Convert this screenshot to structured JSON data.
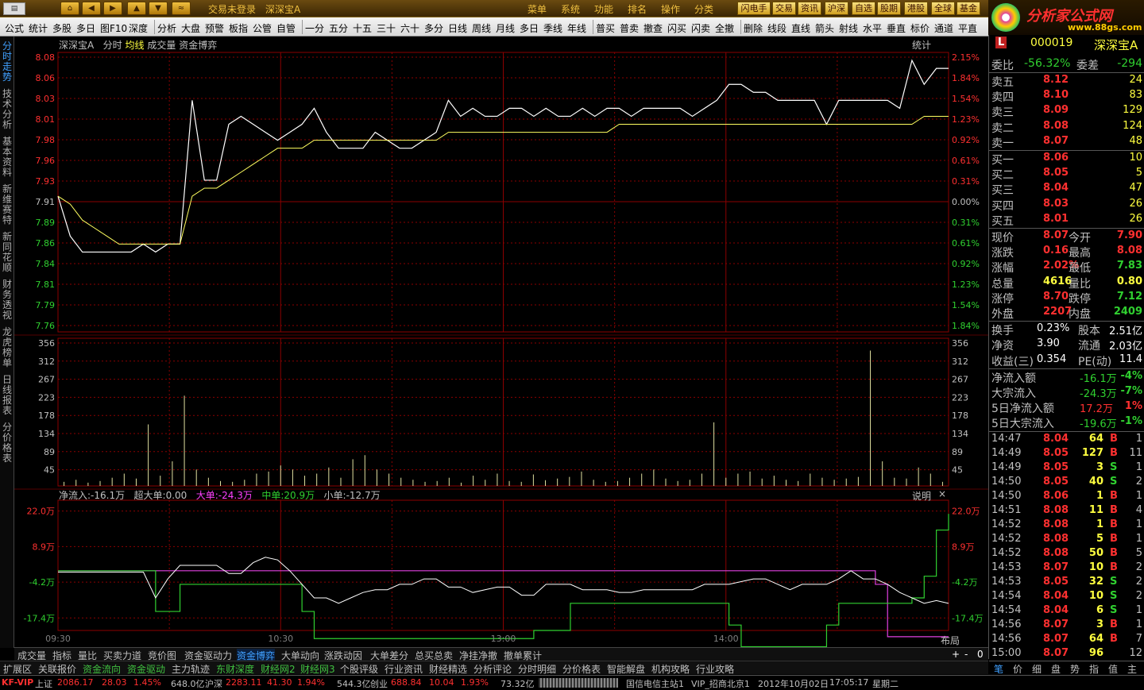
{
  "titlebar": {
    "app_icon": "app-logo-icon",
    "links": [
      "交易未登录",
      "深深宝A"
    ],
    "menus": [
      "菜单",
      "系统",
      "功能",
      "排名",
      "操作",
      "分类"
    ],
    "quick": [
      "闪电手",
      "交易",
      "资讯",
      "沪深",
      "自选",
      "股期",
      "港股",
      "全球",
      "基金"
    ]
  },
  "logo": {
    "brand": "分析家公式网",
    "url": "www.88gs.com"
  },
  "toolbar": {
    "items": [
      "公式",
      "统计",
      "多股",
      "多日",
      "图F10",
      "深度",
      "分析",
      "大盘",
      "预警",
      "板指",
      "公管",
      "自管",
      "一分",
      "五分",
      "十五",
      "三十",
      "六十",
      "多分",
      "日线",
      "周线",
      "月线",
      "多日",
      "季线",
      "年线",
      "普买",
      "普卖",
      "撤查",
      "闪买",
      "闪卖",
      "全撤",
      "删除",
      "线段",
      "直线",
      "箭头",
      "射线",
      "水平",
      "垂直",
      "标价",
      "通道",
      "平直"
    ]
  },
  "vtabs": [
    "分时走势",
    "技术分析",
    "基本资料",
    "新维赛特",
    "新同花顺",
    "财务透视",
    "龙虎榜单",
    "日线报表",
    "分价格表"
  ],
  "chart": {
    "header_name": "深深宝A",
    "header_items": [
      "分时",
      "均线",
      "成交量",
      "资金博弈"
    ],
    "stat_btn": "统计",
    "price_labels": [
      "8.08",
      "8.06",
      "8.03",
      "8.01",
      "7.98",
      "7.96",
      "7.93",
      "7.91",
      "7.89",
      "7.86",
      "7.84",
      "7.81",
      "7.79",
      "7.76"
    ],
    "pct_labels": [
      "2.15%",
      "1.84%",
      "1.54%",
      "1.23%",
      "0.92%",
      "0.61%",
      "0.31%",
      "0.00%",
      "0.31%",
      "0.61%",
      "0.92%",
      "1.23%",
      "1.54%",
      "1.84%"
    ],
    "vol_labels": [
      "356",
      "312",
      "267",
      "223",
      "178",
      "134",
      "89",
      "45"
    ],
    "flow_labels": [
      "22.0万",
      "8.9万",
      "-4.2万",
      "-17.4万"
    ],
    "flow_header": {
      "net": "净流入:-16.1万",
      "super": "超大单:0.00",
      "big": "大单:-24.3万",
      "mid": "中单:20.9万",
      "small": "小单:-12.7万",
      "help": "说明",
      "close": "×"
    },
    "time_labels": [
      "09:30",
      "10:30",
      "13:00",
      "14:00"
    ],
    "layout_btn": "布局",
    "zoom": [
      "+",
      "-",
      "0"
    ]
  },
  "chart_data": {
    "type": "line",
    "title": "深深宝A",
    "preclose": 7.91,
    "price": [
      7.91,
      7.86,
      7.84,
      7.84,
      7.84,
      7.84,
      7.84,
      7.85,
      7.84,
      7.85,
      7.85,
      8.03,
      7.93,
      7.93,
      8.0,
      8.01,
      8.0,
      7.99,
      7.98,
      7.99,
      8.0,
      8.02,
      7.99,
      7.97,
      7.97,
      7.97,
      7.99,
      7.98,
      7.97,
      7.97,
      7.98,
      7.99,
      8.03,
      8.01,
      8.02,
      8.01,
      8.01,
      8.02,
      8.02,
      8.01,
      8.02,
      8.01,
      8.01,
      8.02,
      8.01,
      8.02,
      8.02,
      8.01,
      8.02,
      8.02,
      8.02,
      8.02,
      8.01,
      8.02,
      8.03,
      8.05,
      8.05,
      8.04,
      8.04,
      8.03,
      8.03,
      8.03,
      8.03,
      8.0,
      8.03,
      8.03,
      8.03,
      8.03,
      8.03,
      8.02,
      8.08,
      8.05,
      8.07,
      8.07
    ],
    "avg": [
      7.91,
      7.9,
      7.88,
      7.87,
      7.86,
      7.85,
      7.85,
      7.85,
      7.85,
      7.85,
      7.85,
      7.91,
      7.92,
      7.92,
      7.93,
      7.94,
      7.95,
      7.96,
      7.97,
      7.97,
      7.97,
      7.98,
      7.98,
      7.98,
      7.98,
      7.98,
      7.98,
      7.98,
      7.98,
      7.98,
      7.98,
      7.98,
      7.99,
      7.99,
      7.99,
      7.99,
      7.99,
      7.99,
      7.99,
      7.99,
      7.99,
      7.99,
      7.99,
      7.99,
      7.99,
      7.99,
      8.0,
      8.0,
      8.0,
      8.0,
      8.0,
      8.0,
      8.0,
      8.0,
      8.0,
      8.0,
      8.0,
      8.0,
      8.0,
      8.0,
      8.0,
      8.0,
      8.0,
      8.0,
      8.0,
      8.0,
      8.0,
      8.0,
      8.0,
      8.0,
      8.0,
      8.01,
      8.01,
      8.01
    ],
    "volume": [
      10,
      15,
      8,
      12,
      20,
      30,
      18,
      150,
      25,
      60,
      220,
      40,
      20,
      12,
      10,
      15,
      30,
      35,
      50,
      40,
      25,
      30,
      45,
      20,
      65,
      75,
      40,
      30,
      20,
      15,
      10,
      12,
      20,
      8,
      25,
      15,
      30,
      12,
      10,
      28,
      14,
      18,
      22,
      35,
      15,
      10,
      12,
      20,
      30,
      40,
      18,
      12,
      15,
      30,
      155,
      20,
      30,
      35,
      18,
      25,
      15,
      12,
      30,
      20,
      15,
      18,
      22,
      330,
      60,
      20,
      18,
      45,
      30,
      10
    ],
    "net_flow": [
      -0.5,
      -0.5,
      -0.5,
      -0.5,
      -0.5,
      -0.5,
      -0.5,
      -0.5,
      -10,
      -3,
      2,
      2,
      2,
      2,
      -1,
      -1,
      3,
      5,
      4,
      0,
      -5,
      -10,
      -10,
      -12,
      -10,
      -8,
      -7,
      -7,
      -5,
      -5,
      -3,
      -3,
      -6,
      -6,
      -8,
      -7,
      -6,
      -6,
      -9,
      -9,
      -5,
      -5,
      -5,
      -7,
      -7,
      -7,
      -8,
      -8,
      -7,
      -7,
      -7,
      -7,
      -7,
      -5,
      -5,
      -5,
      -4,
      -3,
      -3,
      -5,
      -7,
      -5,
      -5,
      -5,
      -3,
      0,
      -3,
      -3,
      -5,
      -8,
      -10,
      -12,
      -11,
      -12
    ],
    "big_order": [
      0,
      0,
      0,
      0,
      0,
      0,
      0,
      0,
      0,
      0,
      0,
      0,
      0,
      0,
      0,
      0,
      0,
      0,
      0,
      0,
      0,
      0,
      0,
      0,
      0,
      0,
      0,
      0,
      0,
      0,
      0,
      0,
      0,
      0,
      0,
      0,
      0,
      0,
      0,
      0,
      0,
      0,
      0,
      0,
      0,
      0,
      0,
      0,
      0,
      0,
      0,
      0,
      0,
      0,
      0,
      0,
      0,
      0,
      0,
      0,
      0,
      0,
      0,
      0,
      0,
      0,
      0,
      -5,
      -24.3,
      -24.3,
      -24.3,
      -24.3,
      -24.3,
      -24.3
    ],
    "mid_order": [
      0,
      0,
      0,
      0,
      0,
      0,
      0,
      0,
      -15,
      -15,
      -5,
      -5,
      -5,
      -5,
      -5,
      -5,
      -5,
      -5,
      -5,
      -5,
      -15,
      -25,
      -25,
      -25,
      -25,
      -25,
      -25,
      -25,
      -25,
      -25,
      -25,
      -25,
      -25,
      -25,
      -25,
      -25,
      -25,
      -25,
      -25,
      -22,
      -22,
      -22,
      -12,
      -12,
      -12,
      -12,
      -12,
      -12,
      -12,
      -12,
      -12,
      -12,
      -12,
      -12,
      -12,
      -20,
      -28,
      -28,
      -28,
      -28,
      -28,
      -28,
      -28,
      -20,
      -12,
      -12,
      -12,
      -12,
      -12,
      -12,
      -10,
      -2,
      15,
      21
    ],
    "flow_range": [
      -22,
      26
    ],
    "price_range": [
      7.74,
      8.09
    ],
    "vol_range": [
      0,
      360
    ]
  },
  "quote": {
    "code": "000019",
    "name": "深深宝A",
    "weibi": {
      "label": "委比",
      "value": "-56.32%",
      "diff_label": "委差",
      "diff": "-294"
    },
    "asks": [
      {
        "label": "卖五",
        "price": "8.12",
        "vol": "24"
      },
      {
        "label": "卖四",
        "price": "8.10",
        "vol": "83"
      },
      {
        "label": "卖三",
        "price": "8.09",
        "vol": "129"
      },
      {
        "label": "卖二",
        "price": "8.08",
        "vol": "124"
      },
      {
        "label": "卖一",
        "price": "8.07",
        "vol": "48"
      }
    ],
    "bids": [
      {
        "label": "买一",
        "price": "8.06",
        "vol": "10"
      },
      {
        "label": "买二",
        "price": "8.05",
        "vol": "5"
      },
      {
        "label": "买三",
        "price": "8.04",
        "vol": "47"
      },
      {
        "label": "买四",
        "price": "8.03",
        "vol": "26"
      },
      {
        "label": "买五",
        "price": "8.01",
        "vol": "26"
      }
    ],
    "stats": [
      {
        "l1": "现价",
        "v1": "8.07",
        "l2": "今开",
        "v2": "7.90"
      },
      {
        "l1": "涨跌",
        "v1": "0.16",
        "l2": "最高",
        "v2": "8.08"
      },
      {
        "l1": "涨幅",
        "v1": "2.02%",
        "l2": "最低",
        "v2": "7.83"
      },
      {
        "l1": "总量",
        "v1": "4616",
        "l2": "量比",
        "v2": "0.80"
      },
      {
        "l1": "涨停",
        "v1": "8.70",
        "l2": "跌停",
        "v2": "7.12"
      },
      {
        "l1": "外盘",
        "v1": "2207",
        "l2": "内盘",
        "v2": "2409"
      }
    ],
    "stats2": [
      {
        "l1": "换手",
        "v1": "0.23%",
        "l2": "股本",
        "v2": "2.51亿"
      },
      {
        "l1": "净资",
        "v1": "3.90",
        "l2": "流通",
        "v2": "2.03亿"
      },
      {
        "l1": "收益(三)",
        "v1": "0.354",
        "l2": "PE(动)",
        "v2": "11.4"
      }
    ],
    "flows": [
      {
        "label": "净流入额",
        "value": "-16.1万",
        "pct": "-4%"
      },
      {
        "label": "大宗流入",
        "value": "-24.3万",
        "pct": "-7%"
      },
      {
        "label": "5日净流入额",
        "value": "17.2万",
        "pct": "1%"
      },
      {
        "label": "5日大宗流入",
        "value": "-19.6万",
        "pct": "-1%"
      }
    ],
    "ticks": [
      {
        "t": "14:47",
        "p": "8.04",
        "v": "64",
        "d": "B",
        "n": "1"
      },
      {
        "t": "14:49",
        "p": "8.05",
        "v": "127",
        "d": "B",
        "n": "11"
      },
      {
        "t": "14:49",
        "p": "8.05",
        "v": "3",
        "d": "S",
        "n": "1"
      },
      {
        "t": "14:50",
        "p": "8.05",
        "v": "40",
        "d": "S",
        "n": "2"
      },
      {
        "t": "14:50",
        "p": "8.06",
        "v": "1",
        "d": "B",
        "n": "1"
      },
      {
        "t": "14:51",
        "p": "8.08",
        "v": "11",
        "d": "B",
        "n": "4"
      },
      {
        "t": "14:52",
        "p": "8.08",
        "v": "1",
        "d": "B",
        "n": "1"
      },
      {
        "t": "14:52",
        "p": "8.08",
        "v": "5",
        "d": "B",
        "n": "1"
      },
      {
        "t": "14:52",
        "p": "8.08",
        "v": "50",
        "d": "B",
        "n": "5"
      },
      {
        "t": "14:53",
        "p": "8.07",
        "v": "10",
        "d": "B",
        "n": "2"
      },
      {
        "t": "14:53",
        "p": "8.05",
        "v": "32",
        "d": "S",
        "n": "2"
      },
      {
        "t": "14:54",
        "p": "8.04",
        "v": "10",
        "d": "S",
        "n": "2"
      },
      {
        "t": "14:54",
        "p": "8.04",
        "v": "6",
        "d": "S",
        "n": "1"
      },
      {
        "t": "14:56",
        "p": "8.07",
        "v": "3",
        "d": "B",
        "n": "1"
      },
      {
        "t": "14:56",
        "p": "8.07",
        "v": "64",
        "d": "B",
        "n": "7"
      },
      {
        "t": "15:00",
        "p": "8.07",
        "v": "96",
        "d": "",
        "n": "12"
      }
    ],
    "tabs": [
      "笔",
      "价",
      "细",
      "盘",
      "势",
      "指",
      "值",
      "主"
    ]
  },
  "bottom_tabs1": [
    "成交量",
    "指标",
    "量比",
    "买卖力道",
    "竞价图",
    "资金驱动力",
    "资金博弈",
    "大单动向",
    "涨跌动因",
    "大单差分",
    "总买总卖",
    "净挂净撤",
    "撤单累计"
  ],
  "bottom_tabs2": [
    "扩展区",
    "关联报价",
    "资金流向",
    "资金驱动",
    "主力轨迹",
    "东财深度",
    "财经网2",
    "财经网3",
    "个股评级",
    "行业资讯",
    "财经精选",
    "分析评论",
    "分时明细",
    "分价格表",
    "智能解盘",
    "机构攻略",
    "行业攻略"
  ],
  "status": {
    "kf": "KF-VIP",
    "sh_label": "上证",
    "sh_val": "2086.17",
    "sh_chg": "28.03",
    "sh_pct": "1.45%",
    "sh_amt": "648.0亿",
    "sz_label": "沪深",
    "sz_val": "2283.11",
    "sz_chg": "41.30",
    "sz_pct": "1.94%",
    "sz_amt": "544.3亿",
    "cy_label": "创业",
    "cy_val": "688.84",
    "cy_chg": "10.04",
    "cy_pct": "1.93%",
    "cy_amt": "73.32亿",
    "server": "国信电信主站1",
    "server2": "VIP_招商北京1",
    "date": "2012年10月02日",
    "time": "17:05:17",
    "weekday": "星期二"
  },
  "colors": {
    "up": "#ff3030",
    "down": "#30d030",
    "accent": "#40a0ff",
    "yellow": "#ffff40",
    "grid": "#8b0000"
  }
}
